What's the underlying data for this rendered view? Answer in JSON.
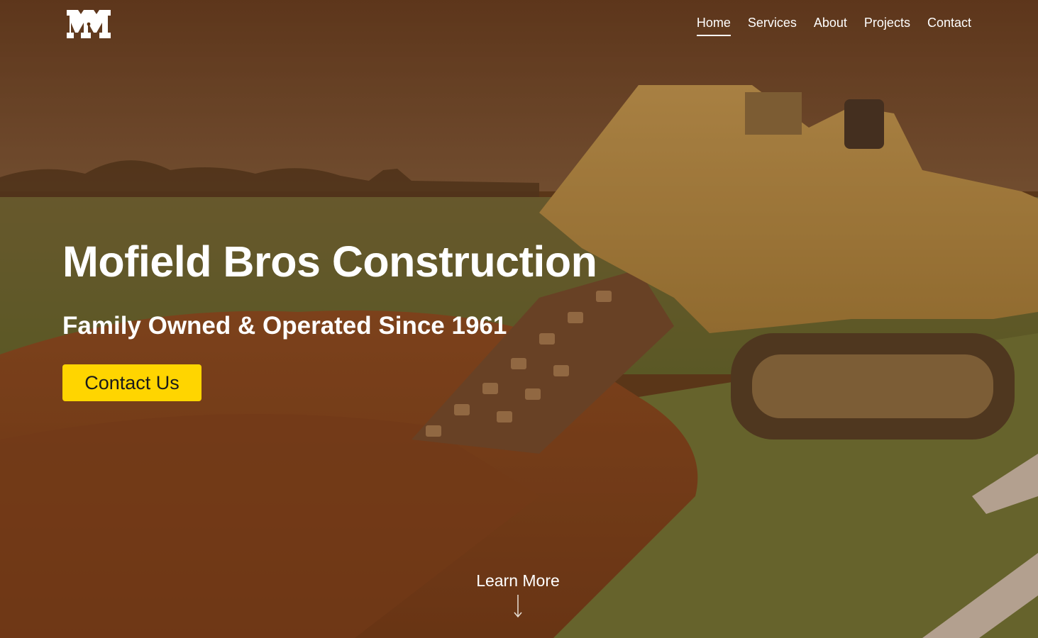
{
  "brand": {
    "logo_icon": "mb-monogram-logo-icon"
  },
  "nav": {
    "items": [
      {
        "label": "Home",
        "active": true
      },
      {
        "label": "Services",
        "active": false
      },
      {
        "label": "About",
        "active": false
      },
      {
        "label": "Projects",
        "active": false
      },
      {
        "label": "Contact",
        "active": false
      }
    ]
  },
  "hero": {
    "title": "Mofield Bros Construction",
    "subtitle": "Family Owned & Operated Since 1961",
    "cta_label": "Contact Us",
    "learn_more_label": "Learn More",
    "learn_more_icon": "arrow-down-icon",
    "background_image": "trencher-machine-photo"
  },
  "colors": {
    "accent": "#ffd500",
    "text": "#ffffff",
    "overlay": "#5c300c"
  }
}
